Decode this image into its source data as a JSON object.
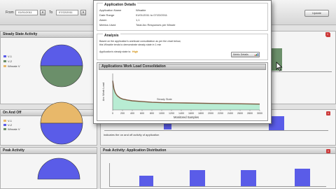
{
  "filters": {
    "from_label": "From",
    "from_value": "01/01/2011",
    "to_label": "To",
    "to_value": "07/22/2011",
    "update_label": "Update"
  },
  "panels": {
    "steady": {
      "title": "Steady State Activity",
      "legend": [
        "V-1",
        "V-2",
        "Winrate V"
      ]
    },
    "onoff": {
      "title": "On And Off",
      "legend": [
        "V-1",
        "V-2",
        "Winrate V"
      ]
    },
    "peak": {
      "title": "Peak Activity"
    },
    "peak_dist": {
      "title": "Peak Activity: Application Distribution"
    },
    "onoff_note": "indicates the on and off activity of application"
  },
  "dialog": {
    "details_title": "Application Details",
    "details": [
      {
        "key": "Application Name",
        "value": "Winable"
      },
      {
        "key": "Date Range",
        "value": "01/01/2011 to 07/22/2011"
      },
      {
        "key": "Alarm",
        "value": "1,1"
      },
      {
        "key": "Metrics Used",
        "value": "Total Arc Responses per Minute"
      }
    ],
    "analysis_title": "Analysis",
    "analysis_text_1": "Based on the application's workload consolidation as per the chart below,",
    "analysis_text_2": "this Winable tends to demonstrate steady state in 1 min",
    "steady_label": "Application's steady state is:",
    "steady_value": "High",
    "metric_button": "Metric Details"
  },
  "colors": {
    "pie_blue": "#5a5ce8",
    "pie_green": "#6b8f6a",
    "pie_orange": "#e8b86a",
    "bar_blue": "#5a5ce8",
    "chart_fill": "#b8ecd3",
    "chart_line": "#7a5a40",
    "close_red": "#cc3b3b"
  },
  "chart_data": {
    "type": "area",
    "title": "Applications Work Load Consolidation",
    "xlabel": "Monitored Samples",
    "ylabel": "Arc Work Load",
    "annotation": "Steady State",
    "x": [
      0,
      25,
      50,
      75,
      100,
      150,
      200,
      300,
      400,
      600,
      800,
      1000,
      1500,
      2000,
      2500,
      3000
    ],
    "y": [
      80,
      58,
      48,
      42,
      38,
      33,
      30,
      27,
      25,
      23,
      21,
      20,
      19,
      18,
      17,
      16
    ],
    "xlim": [
      0,
      3000
    ],
    "ylim": [
      0,
      100
    ],
    "xticks": [
      "0",
      "200",
      "400",
      "600",
      "800",
      "1000",
      "1200",
      "1400",
      "1600",
      "1800",
      "2000",
      "2200",
      "2400",
      "2600",
      "2800",
      "3000"
    ],
    "grid": false,
    "legend": "none"
  }
}
